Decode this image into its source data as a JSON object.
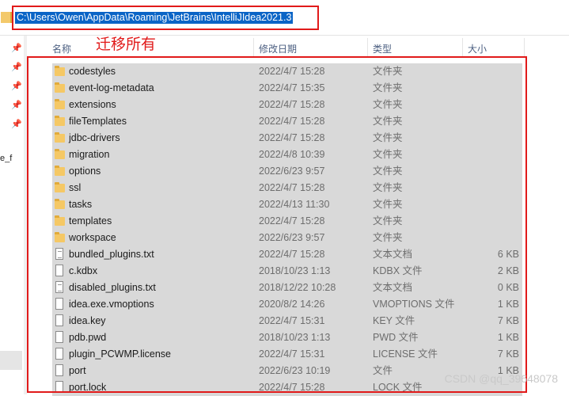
{
  "address_bar": {
    "path": "C:\\Users\\Owen\\AppData\\Roaming\\JetBrains\\IntelliJIdea2021.3"
  },
  "annotation": {
    "text": "迁移所有"
  },
  "sidebar": {
    "truncated_label": "e_f"
  },
  "columns": {
    "name": "名称",
    "date": "修改日期",
    "type": "类型",
    "size": "大小"
  },
  "files": [
    {
      "kind": "folder",
      "name": "codestyles",
      "date": "2022/4/7 15:28",
      "type": "文件夹",
      "size": ""
    },
    {
      "kind": "folder",
      "name": "event-log-metadata",
      "date": "2022/4/7 15:35",
      "type": "文件夹",
      "size": ""
    },
    {
      "kind": "folder",
      "name": "extensions",
      "date": "2022/4/7 15:28",
      "type": "文件夹",
      "size": ""
    },
    {
      "kind": "folder",
      "name": "fileTemplates",
      "date": "2022/4/7 15:28",
      "type": "文件夹",
      "size": ""
    },
    {
      "kind": "folder",
      "name": "jdbc-drivers",
      "date": "2022/4/7 15:28",
      "type": "文件夹",
      "size": ""
    },
    {
      "kind": "folder",
      "name": "migration",
      "date": "2022/4/8 10:39",
      "type": "文件夹",
      "size": ""
    },
    {
      "kind": "folder",
      "name": "options",
      "date": "2022/6/23 9:57",
      "type": "文件夹",
      "size": ""
    },
    {
      "kind": "folder",
      "name": "ssl",
      "date": "2022/4/7 15:28",
      "type": "文件夹",
      "size": ""
    },
    {
      "kind": "folder",
      "name": "tasks",
      "date": "2022/4/13 11:30",
      "type": "文件夹",
      "size": ""
    },
    {
      "kind": "folder",
      "name": "templates",
      "date": "2022/4/7 15:28",
      "type": "文件夹",
      "size": ""
    },
    {
      "kind": "folder",
      "name": "workspace",
      "date": "2022/6/23 9:57",
      "type": "文件夹",
      "size": ""
    },
    {
      "kind": "text-file",
      "name": "bundled_plugins.txt",
      "date": "2022/4/7 15:28",
      "type": "文本文档",
      "size": "6 KB"
    },
    {
      "kind": "file",
      "name": "c.kdbx",
      "date": "2018/10/23 1:13",
      "type": "KDBX 文件",
      "size": "2 KB"
    },
    {
      "kind": "text-file",
      "name": "disabled_plugins.txt",
      "date": "2018/12/22 10:28",
      "type": "文本文档",
      "size": "0 KB"
    },
    {
      "kind": "file",
      "name": "idea.exe.vmoptions",
      "date": "2020/8/2 14:26",
      "type": "VMOPTIONS 文件",
      "size": "1 KB"
    },
    {
      "kind": "file",
      "name": "idea.key",
      "date": "2022/4/7 15:31",
      "type": "KEY 文件",
      "size": "7 KB"
    },
    {
      "kind": "file",
      "name": "pdb.pwd",
      "date": "2018/10/23 1:13",
      "type": "PWD 文件",
      "size": "1 KB"
    },
    {
      "kind": "file",
      "name": "plugin_PCWMP.license",
      "date": "2022/4/7 15:31",
      "type": "LICENSE 文件",
      "size": "7 KB"
    },
    {
      "kind": "file",
      "name": "port",
      "date": "2022/6/23 10:19",
      "type": "文件",
      "size": "1 KB"
    },
    {
      "kind": "file",
      "name": "port.lock",
      "date": "2022/4/7 15:28",
      "type": "LOCK 文件",
      "size": ""
    }
  ],
  "watermark": {
    "text": "CSDN @qq_39648078"
  },
  "colors": {
    "selection": "#d9d9d9",
    "highlight": "#e11a1a",
    "address_selection": "#0a64c6"
  }
}
